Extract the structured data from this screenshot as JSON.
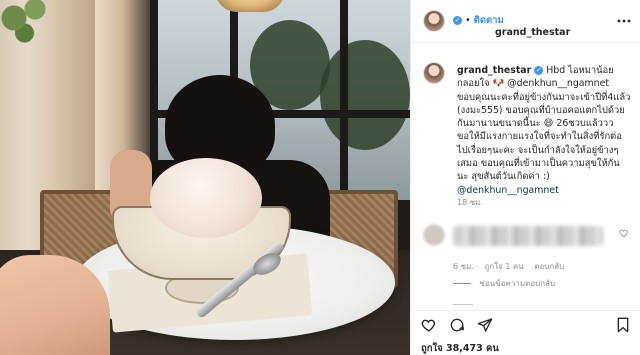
{
  "post": {
    "username": "grand_thestar",
    "verified_badge": "✓",
    "separator": "•",
    "follow_label": "ติดตาม",
    "caption_lines": [
      "Hbd ไอหมาน้อย",
      "กลอยใจ 🐶 @denkhun__ngamnet",
      "ขอบคุณนะคะที่อยู่ข้างกันมาจะเข้าปีที่4แล้ว",
      "(งงมะ555) ขอบคุณที่บ้าบอคอแตกไปด้วย",
      "กันมานานขนาดนี้นะ 😄  26ชวบแล้ววว",
      "ขอให้มีแรงกายแรงใจที่จะทำในสิ่งที่รักต่อ",
      "ไปเรื่อยๆนะคะ จะเป็นกำลังใจให้อยู่ข้างๆ",
      "เสมอ ขอบคุณที่เข้ามาเป็นความสุขให้กัน",
      "นะ สุขสันต์วันเกิดค่า :)",
      "@denkhun__ngamnet"
    ],
    "caption_time": "18 ชม.",
    "comment": {
      "time": "6 ชม.",
      "likes_label": "ถูกใจ 1 คน",
      "reply_label": "ตอบกลับ",
      "view_replies_label": "ซ่อนข้อความตอบกลับ"
    },
    "likes_text": "ถูกใจ 38,473 คน",
    "icons": {
      "more": "more-options-icon",
      "like": "heart-icon",
      "comment": "comment-icon",
      "share": "share-icon",
      "save": "bookmark-icon"
    }
  }
}
